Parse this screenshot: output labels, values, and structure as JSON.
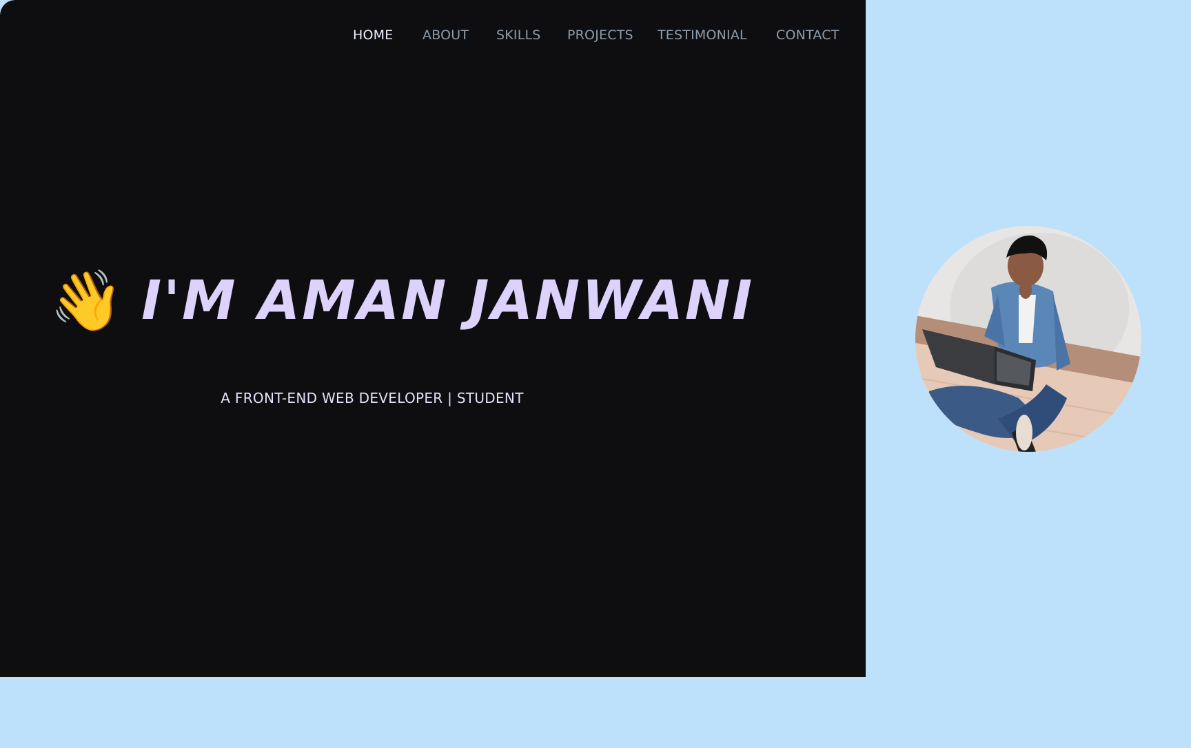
{
  "nav": {
    "items": [
      {
        "label": "HOME",
        "active": true
      },
      {
        "label": "ABOUT",
        "active": false
      },
      {
        "label": "SKILLS",
        "active": false
      },
      {
        "label": "PROJECTS",
        "active": false
      },
      {
        "label": "TESTIMONIAL",
        "active": false
      },
      {
        "label": "CONTACT",
        "active": false
      }
    ]
  },
  "hero": {
    "wave_icon": "waving-hand-icon",
    "wave_glyph": "👋",
    "heading": "I'M AMAN JANWANI",
    "tagline": "A FRONT-END WEB DEVELOPER | STUDENT"
  },
  "profile": {
    "photo": "profile-photo"
  },
  "colors": {
    "page_background": "#bde0fb",
    "hero_background": "#0e0e10",
    "heading_color": "#dcd2fb",
    "nav_active": "#eef2ff",
    "nav_inactive": "#8f9cab"
  }
}
